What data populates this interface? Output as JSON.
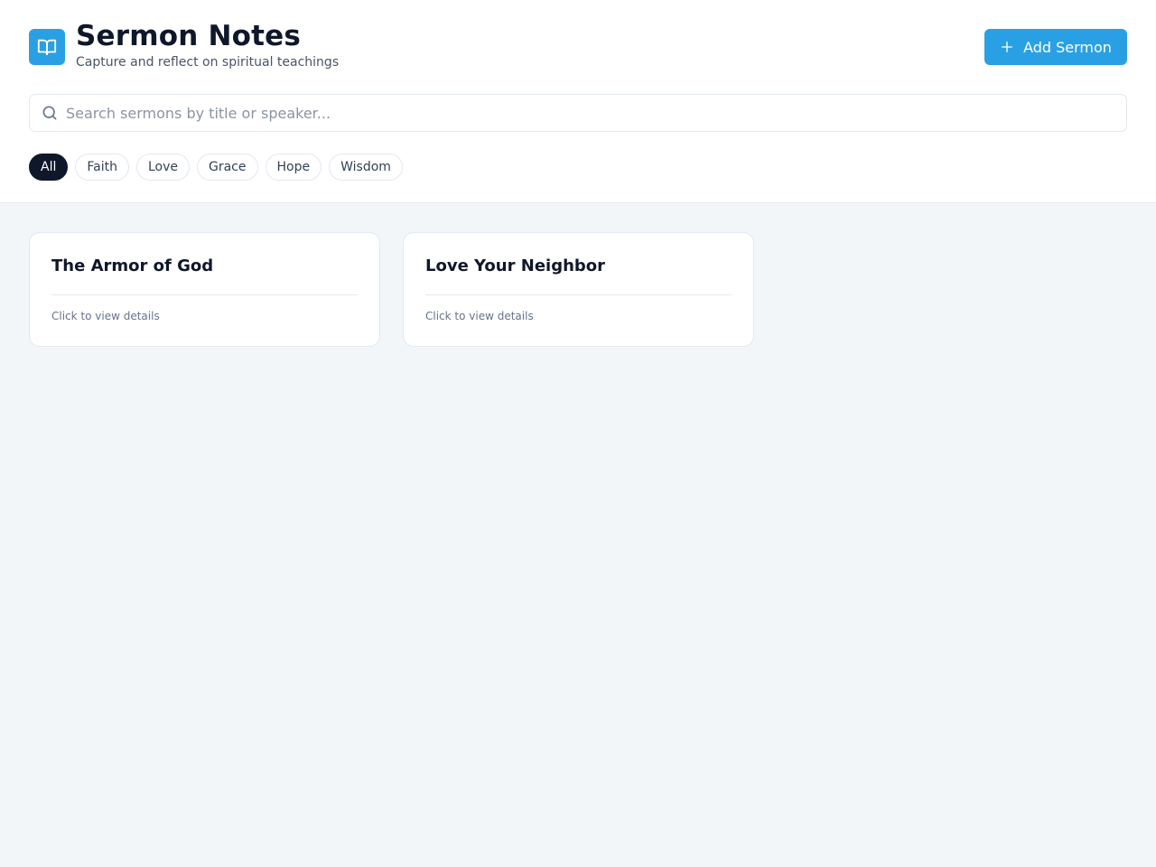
{
  "header": {
    "title": "Sermon Notes",
    "subtitle": "Capture and reflect on spiritual teachings",
    "add_button_label": "Add Sermon",
    "logo_icon": "book-open-icon"
  },
  "search": {
    "placeholder": "Search sermons by title or speaker...",
    "value": ""
  },
  "filters": [
    {
      "label": "All",
      "active": true
    },
    {
      "label": "Faith",
      "active": false
    },
    {
      "label": "Love",
      "active": false
    },
    {
      "label": "Grace",
      "active": false
    },
    {
      "label": "Hope",
      "active": false
    },
    {
      "label": "Wisdom",
      "active": false
    }
  ],
  "sermons": [
    {
      "title": "The Armor of God",
      "hint": "Click to view details"
    },
    {
      "title": "Love Your Neighbor",
      "hint": "Click to view details"
    }
  ],
  "colors": {
    "accent": "#2aa0e4",
    "dark": "#0f172a",
    "background": "#f3f6f9"
  }
}
